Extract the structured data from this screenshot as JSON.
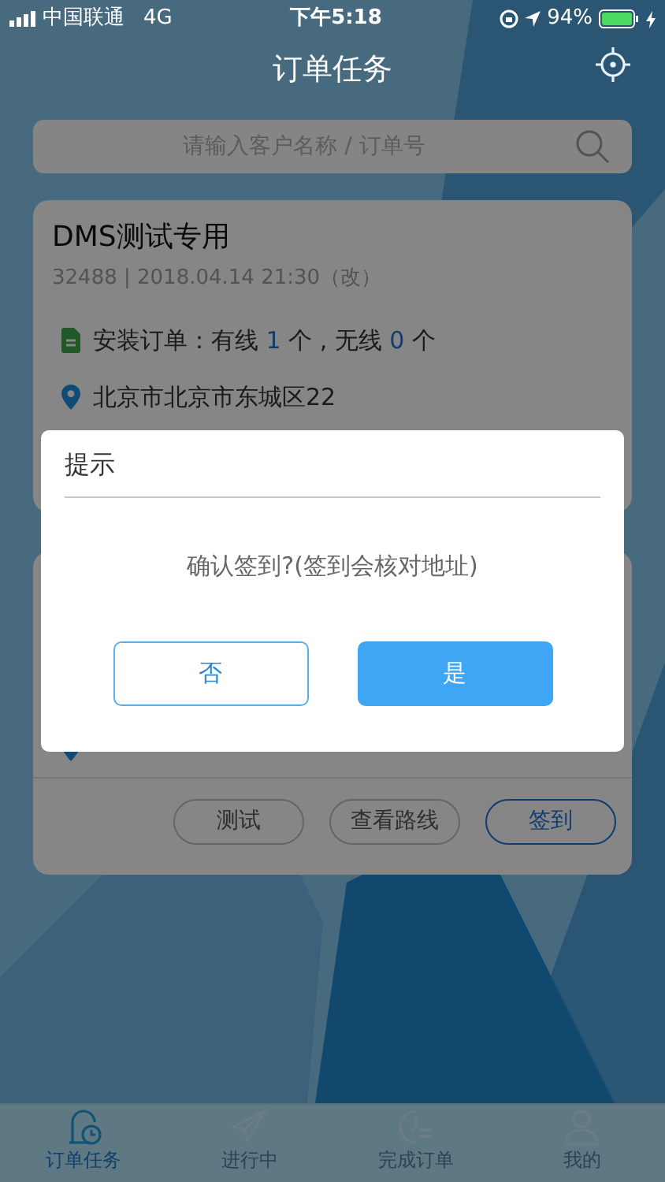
{
  "status_bar": {
    "carrier": "中国联通",
    "network": "4G",
    "time": "下午5:18",
    "battery": "94%"
  },
  "header": {
    "title": "订单任务"
  },
  "search": {
    "placeholder": "请输入客户名称 / 订单号"
  },
  "orders": [
    {
      "title": "DMS测试专用",
      "meta": "32488 | 2018.04.14 21:30（改）",
      "install": {
        "prefix": "安装订单：有线 ",
        "wired": "1",
        "middle": " 个 , 无线 ",
        "wireless": "0",
        "suffix": " 个"
      },
      "address": "北京市北京市东城区22"
    },
    {
      "buttons": [
        {
          "label": "测试",
          "kind": "plain"
        },
        {
          "label": "查看路线",
          "kind": "plain"
        },
        {
          "label": "签到",
          "kind": "primary"
        }
      ]
    }
  ],
  "dialog": {
    "title": "提示",
    "message": "确认签到?(签到会核对地址)",
    "buttons": [
      {
        "label": "否",
        "kind": "outline"
      },
      {
        "label": "是",
        "kind": "primary"
      }
    ]
  },
  "tabs": [
    {
      "label": "订单任务",
      "selected": true
    },
    {
      "label": "进行中",
      "selected": false
    },
    {
      "label": "完成订单",
      "selected": false
    },
    {
      "label": "我的",
      "selected": false
    }
  ]
}
